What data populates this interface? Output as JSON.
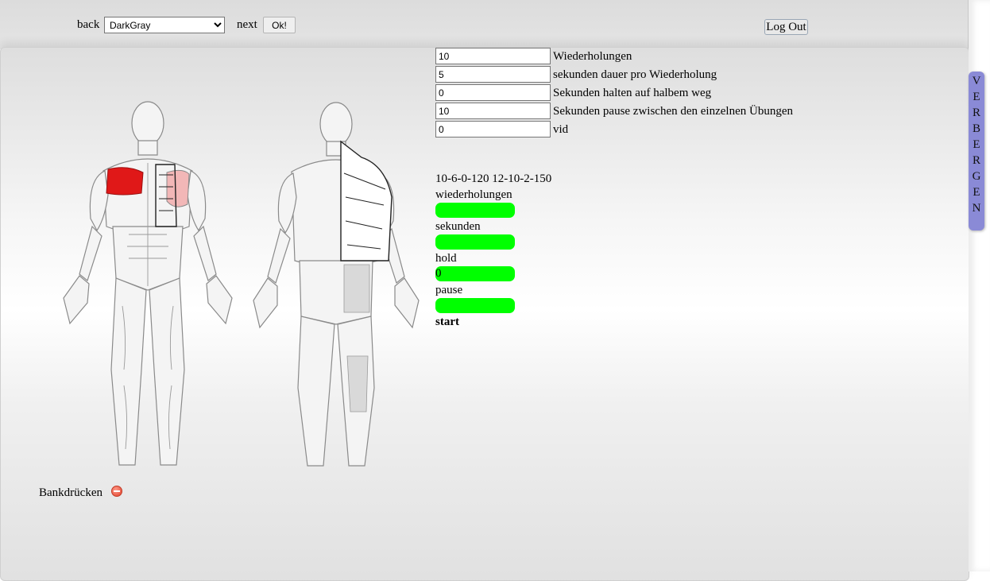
{
  "nav": {
    "back_label": "back",
    "next_label": "next",
    "color_select_value": "DarkGray",
    "ok_label": "Ok!",
    "logout_label": "Log Out"
  },
  "settings": {
    "repetitions_value": "10",
    "repetitions_label": " Wiederholungen",
    "duration_value": "5",
    "duration_label": "sekunden dauer pro Wiederholung",
    "hold_value": "0",
    "hold_label": "Sekunden halten auf halbem weg",
    "pause_value": "10",
    "pause_label": "Sekunden pause zwischen den einzelnen Übungen",
    "vid_value": "0",
    "vid_label": "vid"
  },
  "workout": {
    "code_text": "10-6-0-120 12-10-2-150",
    "repetitions_label": "wiederholungen",
    "repetitions_value": "",
    "seconds_label": "sekunden",
    "seconds_value": "",
    "hold_label": "hold",
    "hold_value": "0",
    "pause_label": "pause",
    "pause_value": "",
    "start_label": "start"
  },
  "exercise": {
    "name": "Bankdrücken"
  },
  "sidebar": {
    "hide_letters": [
      "V",
      "E",
      "R",
      "B",
      "E",
      "R",
      "G",
      "E",
      "N"
    ]
  },
  "colors": {
    "progress": "#00ff00",
    "hide_tab": "#8a8ad6",
    "highlight_muscle": "#e01818"
  }
}
